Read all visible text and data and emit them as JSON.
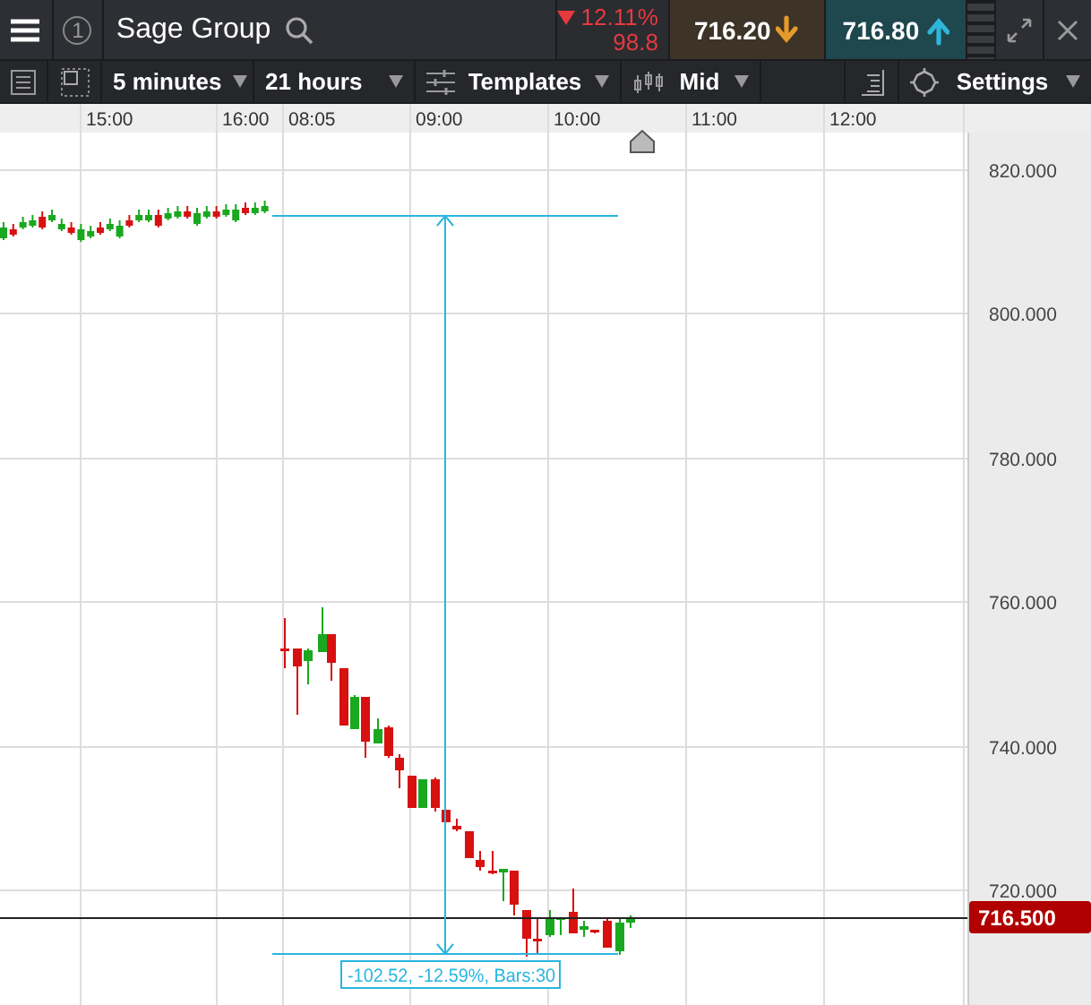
{
  "header": {
    "badge": "1",
    "instrument": "Sage Group",
    "change": {
      "rising": false,
      "percent": "12.11%",
      "points": "98.8"
    },
    "sell": {
      "price": "716.20",
      "rising": false
    },
    "buy": {
      "price": "716.80",
      "rising": true
    }
  },
  "toolbar": {
    "interval": "5 minutes",
    "range": "21 hours",
    "templates": "Templates",
    "price_type": "Mid",
    "settings": "Settings"
  },
  "chart": {
    "time_labels": [
      "15:00",
      "16:00",
      "08:05",
      "09:00",
      "10:00",
      "11:00",
      "12:00"
    ],
    "price_labels": [
      "820.000",
      "800.000",
      "780.000",
      "760.000",
      "740.000",
      "720.000"
    ],
    "current_price": "716.500",
    "measurement": "-102.52, -12.59%, Bars:30"
  }
}
